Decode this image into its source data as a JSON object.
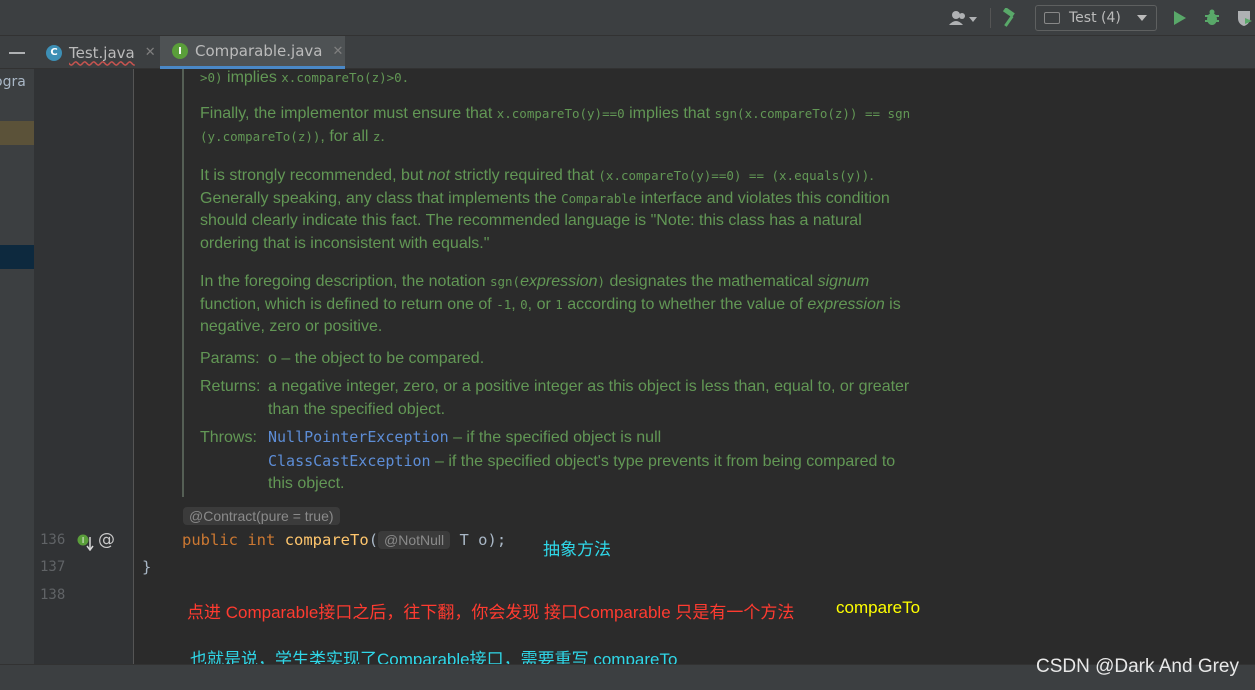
{
  "toolbar": {
    "run_config": "Test (4)"
  },
  "tabs": [
    {
      "label": "Test.java",
      "icon": "C"
    },
    {
      "label": "Comparable.java",
      "icon": "I"
    }
  ],
  "project_panel": {
    "partial_text": "ogra"
  },
  "gutter": {
    "lines": [
      "136",
      "137",
      "138"
    ]
  },
  "doc": {
    "line0": {
      "t1": ">0)",
      "t2": " implies ",
      "t3": "x.compareTo(z)>0."
    },
    "p1": {
      "a": "Finally, the implementor must ensure that ",
      "b": "x.compareTo(y)==0",
      "c": " implies that ",
      "d": "sgn(x.compareTo(z)) == sgn",
      "e": "(y.compareTo(z))",
      "f": ", for all ",
      "g": "z",
      "h": "."
    },
    "p2": {
      "a": "It is strongly recommended, but ",
      "b": "not",
      "c": " strictly required that ",
      "d": "(x.compareTo(y)==0) == (x.equals(y))",
      "e": ".",
      "f": "Generally speaking, any class that implements the ",
      "g": "Comparable",
      "h": " interface and violates this condition",
      "i": "should clearly indicate this fact. The recommended language is \"Note: this class has a natural",
      "j": "ordering that is inconsistent with equals.\""
    },
    "p3": {
      "a": "In the foregoing description, the notation ",
      "b": "sgn(",
      "c": "expression",
      "d": ")",
      "e": " designates the mathematical ",
      "f": "signum",
      "g": "function, which is defined to return one of ",
      "h": "-1",
      "i": ", ",
      "j": "0",
      "k": ", or ",
      "l": "1",
      "m": " according to whether the value of ",
      "n": "expression",
      "o": " is",
      "p": "negative, zero or positive."
    },
    "params_label": "Params:",
    "params_text": "o – the object to be compared.",
    "returns_label": "Returns:",
    "returns_text1": "a negative integer, zero, or a positive integer as this object is less than, equal to, or greater",
    "returns_text2": "than the specified object.",
    "throws_label": "Throws:",
    "throws1_link": "NullPointerException",
    "throws1_text": " – if the specified object is null",
    "throws2_link": "ClassCastException",
    "throws2_text": " – if the specified object's type prevents it from being compared to",
    "throws2_text2": "this object."
  },
  "code": {
    "contract_hint": "@Contract(pure = true)",
    "line136": {
      "kw1": "public",
      "kw2": "int",
      "fn": "compareTo",
      "paren": "(",
      "hint": "@NotNull",
      "rest": "T o);"
    },
    "line137": "}"
  },
  "annotations": {
    "a1": "抽象方法",
    "a2": "点进 Comparable接口之后，往下翻，你会发现 接口Comparable 只是有一个方法",
    "a3": "compareTo",
    "a4": "也就是说，学生类实现了Comparable接口，需要重写 compareTo"
  },
  "watermark": "CSDN @Dark And Grey",
  "colors": {
    "doc_text": "#629755",
    "link": "#5d8dd6",
    "keyword": "#cc7832",
    "method": "#ffc66d",
    "annotation_red": "#ff3b30",
    "annotation_yellow": "#ffff00",
    "annotation_cyan": "#2fd7e8",
    "active_tab_underline": "#4a88c7"
  }
}
